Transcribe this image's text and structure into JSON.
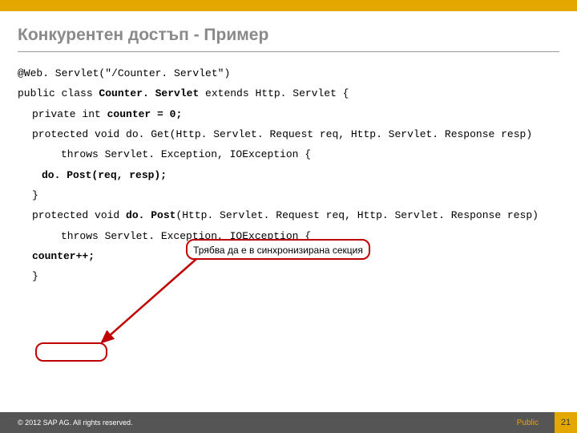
{
  "title": "Конкурентен достъп - Пример",
  "code": {
    "l1a": "@Web. Servlet(\"/Counter. Servlet\")",
    "l2a": "public class ",
    "l2b": "Counter. Servlet ",
    "l2c": "extends ",
    "l2d": "Http. Servlet {",
    "l3a": "private int ",
    "l3b": "counter = 0;",
    "l4a": "protected void ",
    "l4b": "do. Get(Http. Servlet. Request req, Http. Servlet. Response resp)",
    "l5a": "throws ",
    "l5b": "Servlet. Exception, IOException {",
    "l6a": "do. Post(req, resp);",
    "l7a": "}",
    "l8a": "protected void ",
    "l8b": "do. Post",
    "l8c": "(Http. Servlet. Request req, Http. Servlet. Response resp)",
    "l9a": "throws ",
    "l9b": "Servlet. Exception, IOException {",
    "l10a": "counter++;",
    "l11a": "}"
  },
  "callout": "Трябва да е в синхронизирана секция",
  "footer": {
    "copyright": "© 2012 SAP AG. All rights reserved.",
    "label": "Public",
    "page": "21"
  }
}
